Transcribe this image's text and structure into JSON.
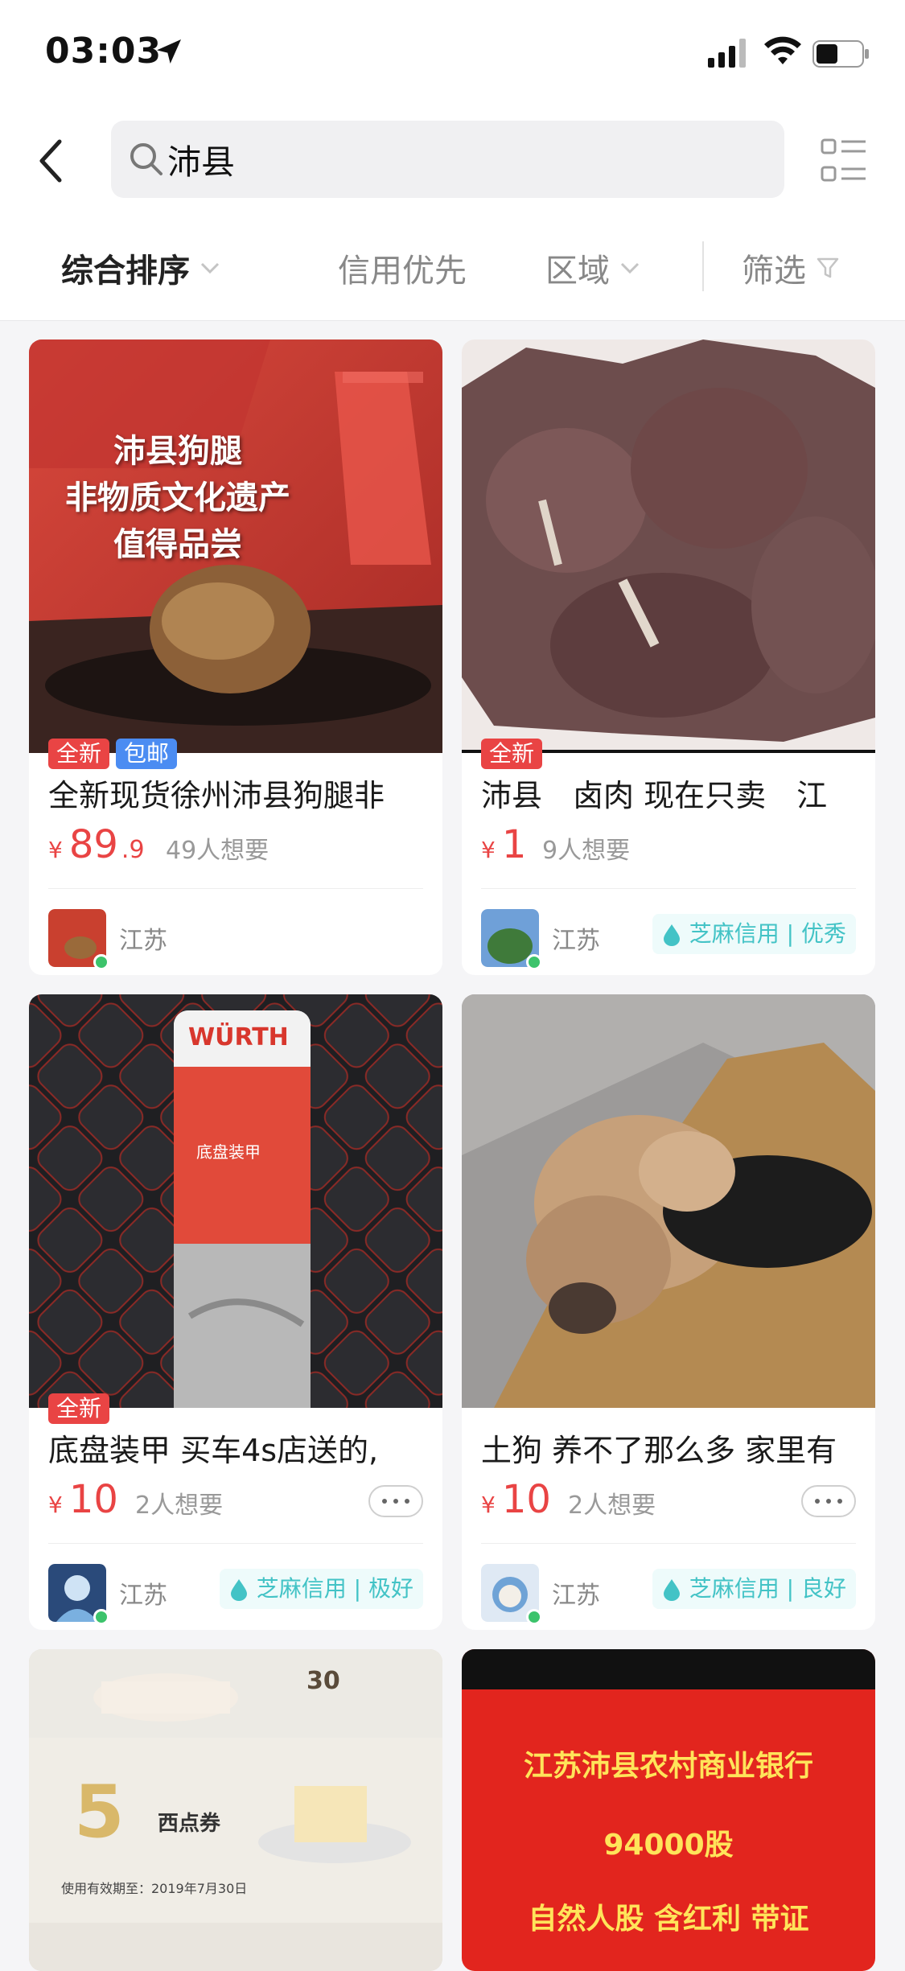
{
  "status_bar": {
    "time": "03:03"
  },
  "search": {
    "query": "沛县"
  },
  "filters": {
    "sort": "综合排序",
    "credit_first": "信用优先",
    "region": "区域",
    "filter": "筛选"
  },
  "colors": {
    "price": "#e94444",
    "credit": "#43c3c6",
    "tag_new": "#e94444",
    "tag_ship": "#4b8cf2"
  },
  "items": [
    {
      "image_text": [
        "沛县狗腿",
        "非物质文化遗产",
        "值得品尝"
      ],
      "tags": [
        "全新",
        "包邮"
      ],
      "title": "全新现货徐州沛县狗腿非",
      "currency": "¥",
      "price_int": "89",
      "price_dec": ".9",
      "want": "49人想要",
      "region": "江苏"
    },
    {
      "tags": [
        "全新"
      ],
      "title": "沛县　卤肉 现在只卖　江",
      "currency": "¥",
      "price_int": "1",
      "want": "9人想要",
      "region": "江苏",
      "credit": "芝麻信用 | 优秀"
    },
    {
      "image_text": [
        "WÜRTH",
        "底盘装甲"
      ],
      "tags": [
        "全新"
      ],
      "title": "底盘装甲 买车4s店送的,",
      "currency": "¥",
      "price_int": "10",
      "want": "2人想要",
      "region": "江苏",
      "credit": "芝麻信用 | 极好"
    },
    {
      "title": "土狗 养不了那么多 家里有",
      "currency": "¥",
      "price_int": "10",
      "want": "2人想要",
      "region": "江苏",
      "credit": "芝麻信用 | 良好"
    },
    {
      "image_text": [
        "30",
        "5",
        "西点券",
        "使用有效期至：2019年7月30日"
      ]
    },
    {
      "image_text": [
        "江苏沛县农村商业银行",
        "94000股",
        "自然人股 含红利 带证"
      ]
    }
  ]
}
